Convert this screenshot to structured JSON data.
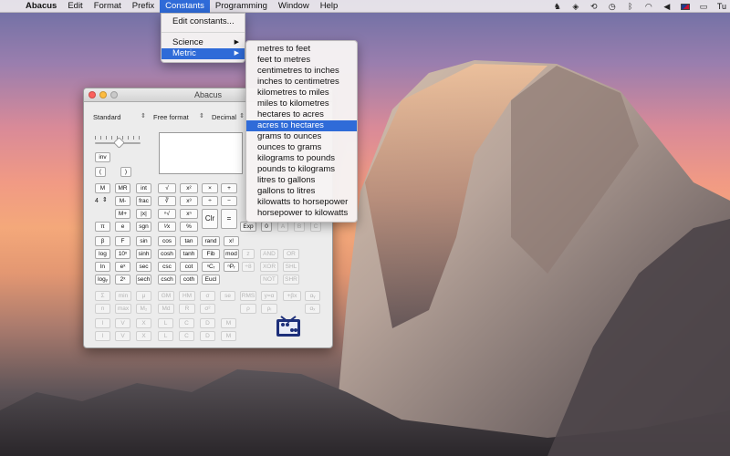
{
  "menubar": {
    "apple_icon": "apple-icon",
    "app_name": "Abacus",
    "items": [
      "Edit",
      "Format",
      "Prefix",
      "Constants",
      "Programming",
      "Window",
      "Help"
    ],
    "active_item": "Constants",
    "status_icons": [
      "evernote-icon",
      "dropbox-icon",
      "sync-icon",
      "time-machine-icon",
      "bluetooth-icon",
      "wifi-icon",
      "volume-icon",
      "flag-icon",
      "battery-icon"
    ],
    "clock_partial": "Tu"
  },
  "constants_menu": {
    "items": [
      {
        "label": "Edit constants...",
        "submenu": false
      },
      {
        "label": "Science",
        "submenu": true
      },
      {
        "label": "Metric",
        "submenu": true,
        "highlighted": true
      }
    ]
  },
  "metric_menu": {
    "items": [
      "metres to feet",
      "feet to metres",
      "centimetres to inches",
      "inches to centimetres",
      "kilometres to miles",
      "miles to kilometres",
      "hectares to acres",
      "acres to hectares",
      "grams to ounces",
      "ounces to grams",
      "kilograms to pounds",
      "pounds to kilograms",
      "litres to gallons",
      "gallons to litres",
      "kilowatts to horsepower",
      "horsepower to kilowatts"
    ],
    "highlighted": "acres to hectares"
  },
  "window": {
    "title": "Abacus",
    "mode_select": "Standard",
    "format_select": "Free format",
    "base_select": "Decimal",
    "stepper_value": "4",
    "buttons": {
      "inv": "inv",
      "lparen": "(",
      "rparen": ")",
      "M": "M",
      "MR": "MR",
      "int": "int",
      "sqrt": "√",
      "x2": "x²",
      "mul": "×",
      "add": "+",
      "Mminus": "M-",
      "frac": "frac",
      "cbrt": "∛",
      "x3": "x³",
      "div": "÷",
      "sub": "−",
      "Mplus": "M+",
      "abs": "|x|",
      "nrt": "ⁿ√",
      "xn": "xⁿ",
      "clr": "Clr",
      "eq": "=",
      "pi": "π",
      "e": "e",
      "sgn": "sgn",
      "inv_x": "¹⁄x",
      "pct": "%",
      "exp": "Exp",
      "zero": "0",
      "A": "A",
      "B": "B",
      "C": "C",
      "beta": "β",
      "F": "F",
      "sin": "sin",
      "cos": "cos",
      "tan": "tan",
      "rand": "rand",
      "fact": "x!",
      "log": "log",
      "tenx": "10ˣ",
      "sinh": "sinh",
      "cosh": "cosh",
      "tanh": "tanh",
      "fib": "Fib",
      "mod": "mod",
      "z": "z",
      "and": "AND",
      "or": "OR",
      "ln": "ln",
      "ex": "eˣ",
      "sec": "sec",
      "csc": "csc",
      "cot": "cot",
      "ncr": "ⁿCᵣ",
      "npr": "ⁿPᵣ",
      "shl_sym": "÷8",
      "xor": "XOR",
      "shl": "SHL",
      "logy": "logᵧ",
      "twox": "2ˣ",
      "sech": "sech",
      "csch": "csch",
      "coth": "coth",
      "eucl": "Eucl",
      "not": "NOT",
      "shr": "SHR",
      "sigma": "Σ",
      "min": "min",
      "mu": "μ",
      "gm": "GM",
      "hm": "HM",
      "sd": "σ",
      "se": "se",
      "rms": "RMS",
      "yx": "y=α",
      "alpha_b": "+βx",
      "alpha_y": "αᵧ",
      "n": "n",
      "max": "max",
      "m2": "M₂",
      "md": "Md",
      "R": "R",
      "s2": "σ²",
      "rho": "ρ",
      "rhox": "ρᵢ",
      "ax": "αₓ",
      "stat_i": "I",
      "stat_v": "V",
      "stat_x": "X",
      "stat_l": "L",
      "stat_c": "C",
      "stat_d": "D",
      "stat_m": "M",
      "row2_i": "I",
      "row2_v": "V",
      "row2_x": "X",
      "row2_l": "L",
      "row2_c": "C",
      "row2_d": "D",
      "row2_m": "M"
    }
  },
  "colors": {
    "highlight": "#2f6bd8",
    "close": "#fc605c",
    "minimize": "#fdbc40"
  }
}
